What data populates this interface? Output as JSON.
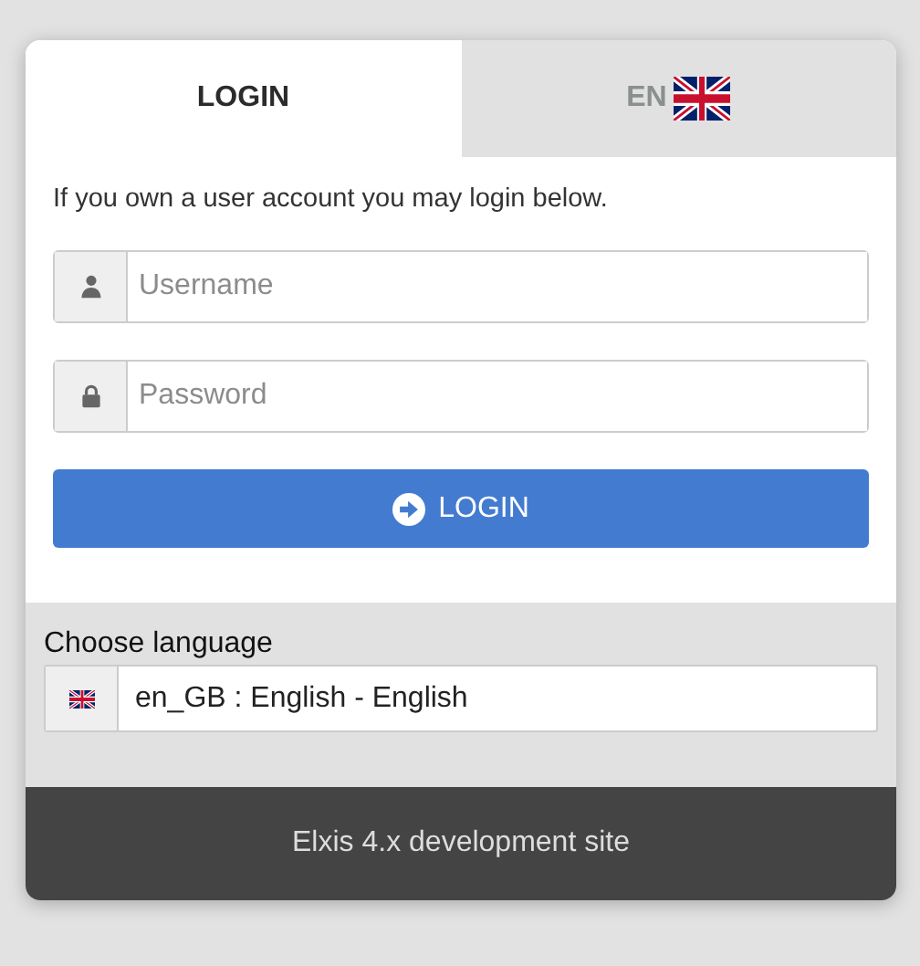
{
  "tabs": [
    {
      "label": "LOGIN",
      "selected": true,
      "kind": "text"
    },
    {
      "label": "EN",
      "selected": false,
      "kind": "flag"
    }
  ],
  "intro": "If you own a user account you may login below.",
  "fields": [
    {
      "kind": "user",
      "placeholder": "Username"
    },
    {
      "kind": "lock",
      "placeholder": "Password"
    }
  ],
  "login_button": "LOGIN",
  "language": {
    "label": "Choose language",
    "value": "en_GB : English - English"
  },
  "footer": "Elxis 4.x development site"
}
